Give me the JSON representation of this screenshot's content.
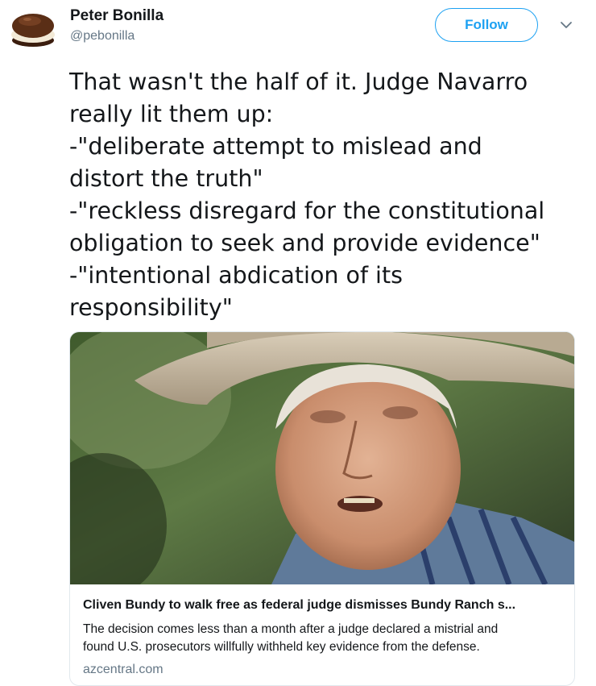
{
  "author": {
    "name": "Peter Bonilla",
    "handle": "@pebonilla",
    "avatar_icon": "chocolate-cake-icon"
  },
  "header": {
    "follow_label": "Follow",
    "menu_icon": "chevron-down-icon"
  },
  "tweet": {
    "lines": [
      "That wasn't the half of it. Judge Navarro",
      "really lit them up:",
      "-\"deliberate attempt to mislead and",
      "distort the truth\"",
      "-\"reckless disregard for the constitutional",
      "obligation to seek and provide evidence\"",
      "-\"intentional abdication of its",
      "responsibility\""
    ]
  },
  "card": {
    "image_icon": "news-photo-man-in-cowboy-hat",
    "title": "Cliven Bundy to walk free as federal judge dismisses Bundy Ranch s...",
    "description_lines": [
      "The decision comes less than a month after a judge declared a mistrial and",
      "found U.S. prosecutors willfully withheld key evidence from the defense."
    ],
    "domain": "azcentral.com"
  },
  "colors": {
    "accent": "#1da1f2",
    "secondary_text": "#657786",
    "border": "#e1e8ed",
    "text": "#14171a"
  }
}
